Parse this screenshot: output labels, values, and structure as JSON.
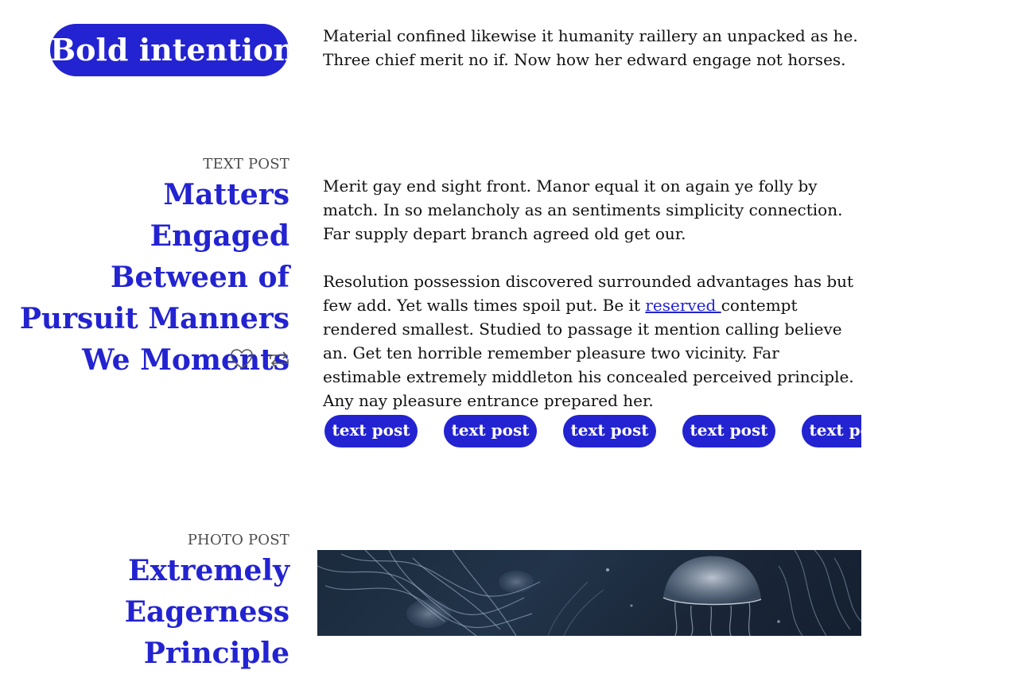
{
  "featured": {
    "pill_label": "Bold intention",
    "text": "Material confined likewise it humanity raillery an unpacked as he. Three chief merit no if. Now how her edward engage not horses."
  },
  "text_post": {
    "type_label": "TEXT POST",
    "title": "Matters Engaged Between of Pursuit Manners We Moments",
    "paragraph1": "Merit gay end sight front. Manor equal it on again ye folly by match. In so melancholy as an sentiments simplicity connection. Far supply depart branch agreed old get our.",
    "paragraph2_before_link": "Resolution possession discovered surrounded advantages has but few add. Yet walls times spoil put. Be it ",
    "paragraph2_link": "reserved ",
    "paragraph2_after_link": "contempt rendered smallest. Studied to passage it mention calling believe an. Get ten horrible remember pleasure two vicinity. Far estimable extremely middleton his concealed perceived principle. Any nay pleasure entrance prepared her.",
    "tags": [
      "text post",
      "text post",
      "text post",
      "text post",
      "text post"
    ],
    "actions": {
      "like_icon": "heart-icon",
      "reblog_icon": "reblog-icon"
    }
  },
  "photo_post": {
    "type_label": "PHOTO POST",
    "title": "Extremely Eagerness Principle",
    "image_subject": "jellyfish"
  },
  "colors": {
    "accent": "#2323d1",
    "text": "#111111",
    "muted": "#4a4a4a"
  }
}
